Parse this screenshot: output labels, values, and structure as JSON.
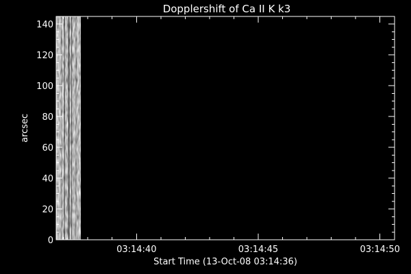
{
  "chart_data": {
    "type": "heatmap",
    "title": "Dopplershift of Ca II K k3",
    "xlabel": "Start Time (13-Oct-08 03:14:36)",
    "ylabel": "arcsec",
    "xlim_seconds": [
      36.7,
      50.6
    ],
    "ylim": [
      0,
      145
    ],
    "x_ticks": [
      {
        "seconds": 40,
        "label": "03:14:40"
      },
      {
        "seconds": 45,
        "label": "03:14:45"
      },
      {
        "seconds": 50,
        "label": "03:14:50"
      }
    ],
    "x_minor_step_seconds": 1,
    "y_ticks": [
      0,
      20,
      40,
      60,
      80,
      100,
      120,
      140
    ],
    "y_minor_step": 5,
    "data_extent_seconds": [
      36.7,
      37.7
    ],
    "colormap": "grayscale",
    "grid": false,
    "colors": {
      "background": "#000000",
      "foreground": "#ffffff"
    }
  }
}
